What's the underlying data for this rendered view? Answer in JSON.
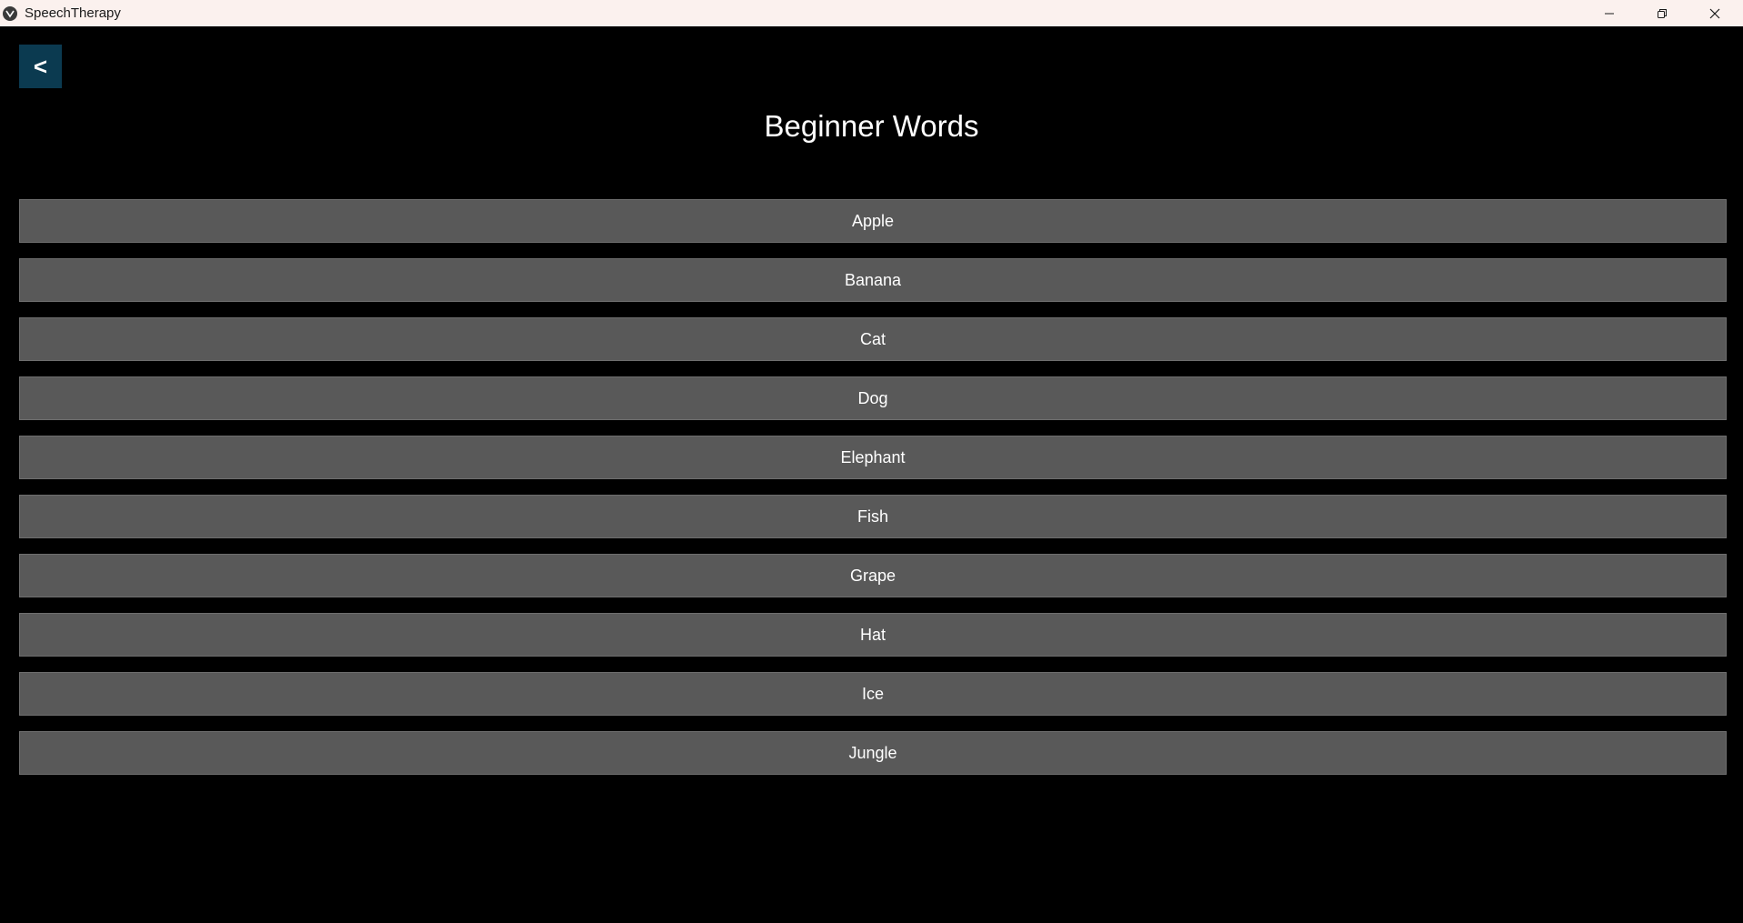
{
  "window": {
    "title": "SpeechTherapy",
    "controls": [
      "minimize-icon",
      "restore-icon",
      "close-icon"
    ]
  },
  "header": {
    "back_label": "<",
    "title": "Beginner Words"
  },
  "words": [
    {
      "label": "Apple"
    },
    {
      "label": "Banana"
    },
    {
      "label": "Cat"
    },
    {
      "label": "Dog"
    },
    {
      "label": "Elephant"
    },
    {
      "label": "Fish"
    },
    {
      "label": "Grape"
    },
    {
      "label": "Hat"
    },
    {
      "label": "Ice"
    },
    {
      "label": "Jungle"
    }
  ],
  "colors": {
    "background": "#000000",
    "titlebar": "#fbf1ee",
    "back_button": "#0b3a50",
    "word_button": "#595959"
  }
}
